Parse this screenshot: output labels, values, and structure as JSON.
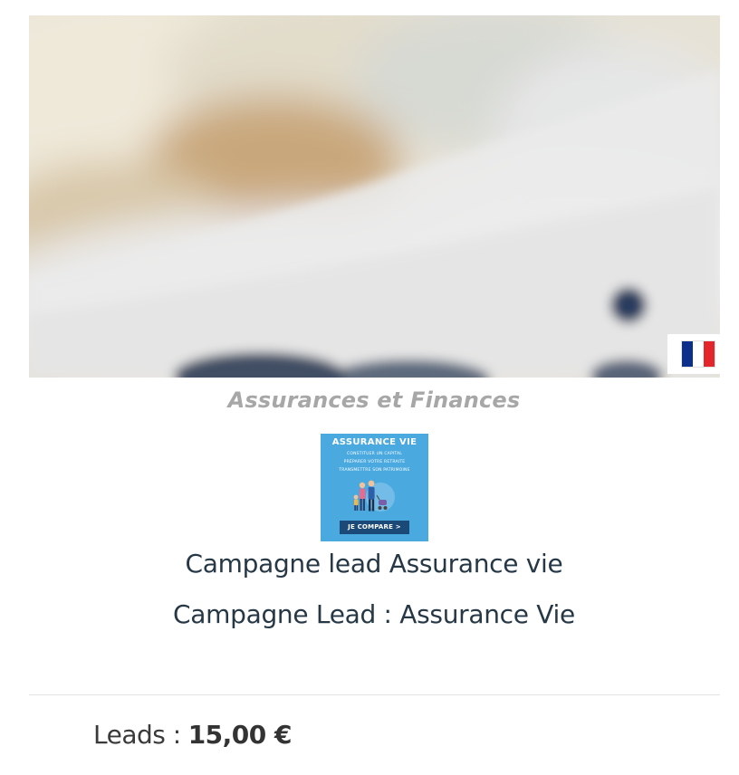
{
  "card": {
    "category": "Assurances et Finances",
    "title": "Campagne lead Assurance vie",
    "subtitle": "Campagne Lead : Assurance Vie",
    "price_label": "Leads :",
    "price_value": "15,00 €",
    "country_flag": "fr-flag-icon"
  },
  "banner": {
    "title": "ASSURANCE VIE",
    "lines": [
      "CONSTITUER UN CAPITAL",
      "PRÉPARER VOTRE RETRAITE",
      "TRANSMETTRE SON PATRIMOINE"
    ],
    "button": "JE COMPARE >"
  },
  "colors": {
    "banner_bg": "#4aa9df",
    "banner_button": "#1c4a78",
    "title_text": "#263846",
    "category_text": "#a7a7a7",
    "flag_blue": "#0d2f8c",
    "flag_white": "#ffffff",
    "flag_red": "#e3262b"
  }
}
